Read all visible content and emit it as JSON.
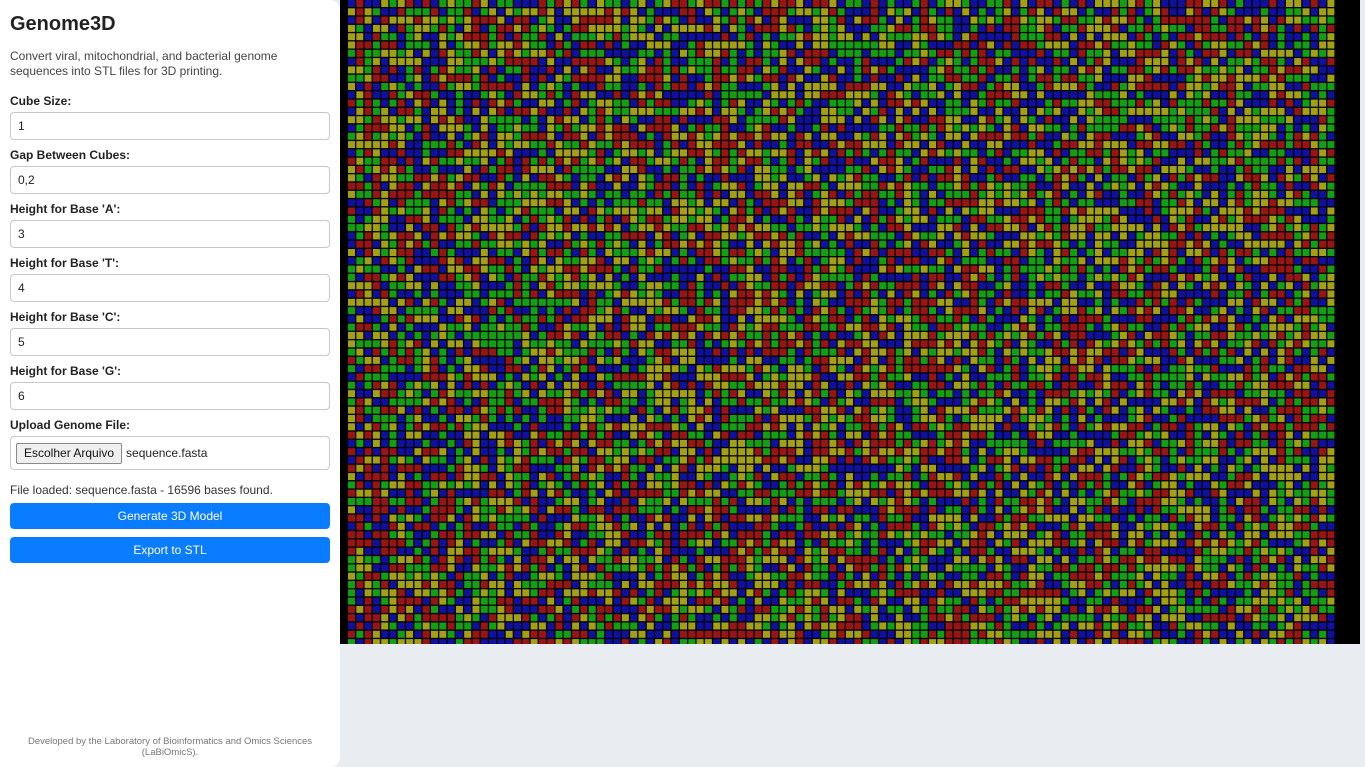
{
  "app": {
    "title": "Genome3D",
    "description": "Convert viral, mitochondrial, and bacterial genome sequences into STL files for 3D printing."
  },
  "form": {
    "cube_size": {
      "label": "Cube Size:",
      "value": "1"
    },
    "gap": {
      "label": "Gap Between Cubes:",
      "value": "0,2"
    },
    "height_a": {
      "label": "Height for Base 'A':",
      "value": "3"
    },
    "height_t": {
      "label": "Height for Base 'T':",
      "value": "4"
    },
    "height_c": {
      "label": "Height for Base 'C':",
      "value": "5"
    },
    "height_g": {
      "label": "Height for Base 'G':",
      "value": "6"
    },
    "upload": {
      "label": "Upload Genome File:",
      "button_label": "Escolher Arquivo",
      "file_name": "sequence.fasta"
    }
  },
  "status_text": "File loaded: sequence.fasta - 16596 bases found.",
  "buttons": {
    "generate": "Generate 3D Model",
    "export": "Export to STL"
  },
  "footer": "Developed by the Laboratory of Bioinformatics and Omics Sciences (LaBiOmicS).",
  "viewer": {
    "background": "#000000",
    "base_colors": {
      "A": "#1010a0",
      "T": "#9a1414",
      "C": "#11a011",
      "G": "#a3a014"
    }
  }
}
